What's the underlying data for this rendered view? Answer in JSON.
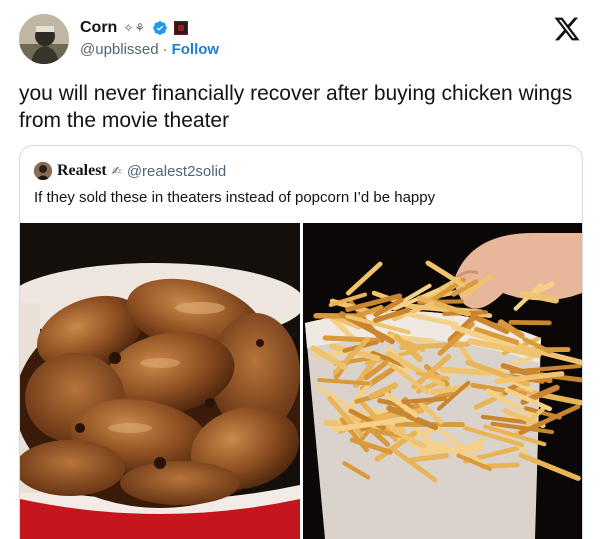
{
  "tweet": {
    "display_name": "Corn",
    "name_emoji": "✧⚘",
    "handle": "@upblissed",
    "separator": "·",
    "follow_label": "Follow",
    "text": "you will never financially recover after buying chicken wings from the movie theater"
  },
  "quoted": {
    "display_name": "Realest",
    "name_emoji": "✍",
    "handle": "@realest2solid",
    "text": "If they sold these in theaters instead of popcorn I’d be happy"
  },
  "media": [
    {
      "icon": "chicken-wings-bucket-photo"
    },
    {
      "icon": "french-fries-cup-photo"
    }
  ],
  "colors": {
    "follow": "#1d7fd0",
    "verified": "#1d9bf0",
    "muted": "#536471",
    "border": "#cfd9de"
  }
}
